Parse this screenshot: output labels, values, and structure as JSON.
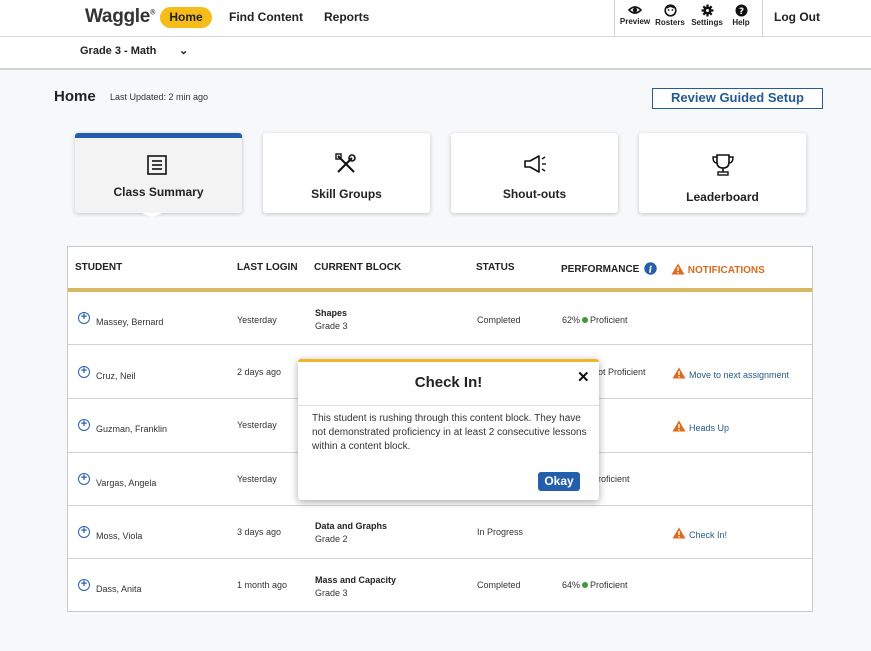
{
  "app": {
    "logo": "Waggle",
    "nav": {
      "home": "Home",
      "find_content": "Find Content",
      "reports": "Reports"
    },
    "tools": [
      {
        "label": "Preview",
        "icon": "eye-icon"
      },
      {
        "label": "Rosters",
        "icon": "face-icon"
      },
      {
        "label": "Settings",
        "icon": "gear-icon"
      },
      {
        "label": "Help",
        "icon": "help-icon"
      }
    ],
    "logout": "Log Out"
  },
  "grade": {
    "label": "Grade 3 - Math"
  },
  "header": {
    "title": "Home",
    "last_updated": "Last Updated: 2 min ago",
    "review_button": "Review Guided Setup"
  },
  "cards": [
    {
      "label": "Class Summary",
      "icon": "list-icon"
    },
    {
      "label": "Skill Groups",
      "icon": "tools-icon"
    },
    {
      "label": "Shout-outs",
      "icon": "megaphone-icon"
    },
    {
      "label": "Leaderboard",
      "icon": "trophy-icon"
    }
  ],
  "table": {
    "columns": {
      "student": "STUDENT",
      "last_login": "LAST LOGIN",
      "current_block": "CURRENT BLOCK",
      "status": "STATUS",
      "performance": "PERFORMANCE",
      "notifications": "NOTIFICATIONS"
    },
    "rows": [
      {
        "name": "Massey, Bernard",
        "last_login": "Yesterday",
        "block": "Shapes",
        "block_grade": "Grade 3",
        "status": "Completed",
        "perf_pct": "62%",
        "perf_label": "Proficient",
        "notification": ""
      },
      {
        "name": "Cruz, Neil",
        "last_login": "2 days ago",
        "block": "",
        "block_grade": "",
        "status": "",
        "perf_pct": "",
        "perf_label": "ot Proficient",
        "notification": "Move to next assignment"
      },
      {
        "name": "Guzman, Franklin",
        "last_login": "Yesterday",
        "block": "",
        "block_grade": "",
        "status": "",
        "perf_pct": "",
        "perf_label": "",
        "notification": "Heads Up"
      },
      {
        "name": "Vargas, Angela",
        "last_login": "Yesterday",
        "block": "",
        "block_grade": "",
        "status": "",
        "perf_pct": "",
        "perf_label": "roficient",
        "notification": ""
      },
      {
        "name": "Moss, Viola",
        "last_login": "3 days ago",
        "block": "Data and Graphs",
        "block_grade": "Grade 2",
        "status": "In Progress",
        "perf_pct": "",
        "perf_label": "",
        "notification": "Check In!"
      },
      {
        "name": "Dass, Anita",
        "last_login": "1 month ago",
        "block": "Mass and Capacity",
        "block_grade": "Grade 3",
        "status": "Completed",
        "perf_pct": "64%",
        "perf_label": "Proficient",
        "notification": ""
      }
    ]
  },
  "modal": {
    "title": "Check In!",
    "body": "This student is rushing through this content block. They have not demonstrated proficiency in at least 2 consecutive lessons within a content block.",
    "button": "Okay"
  },
  "colors": {
    "accent_yellow": "#f6bd1a",
    "brand_blue": "#245fae",
    "warning_orange": "#d86b1c",
    "proficient_green": "#3a9a3a"
  }
}
